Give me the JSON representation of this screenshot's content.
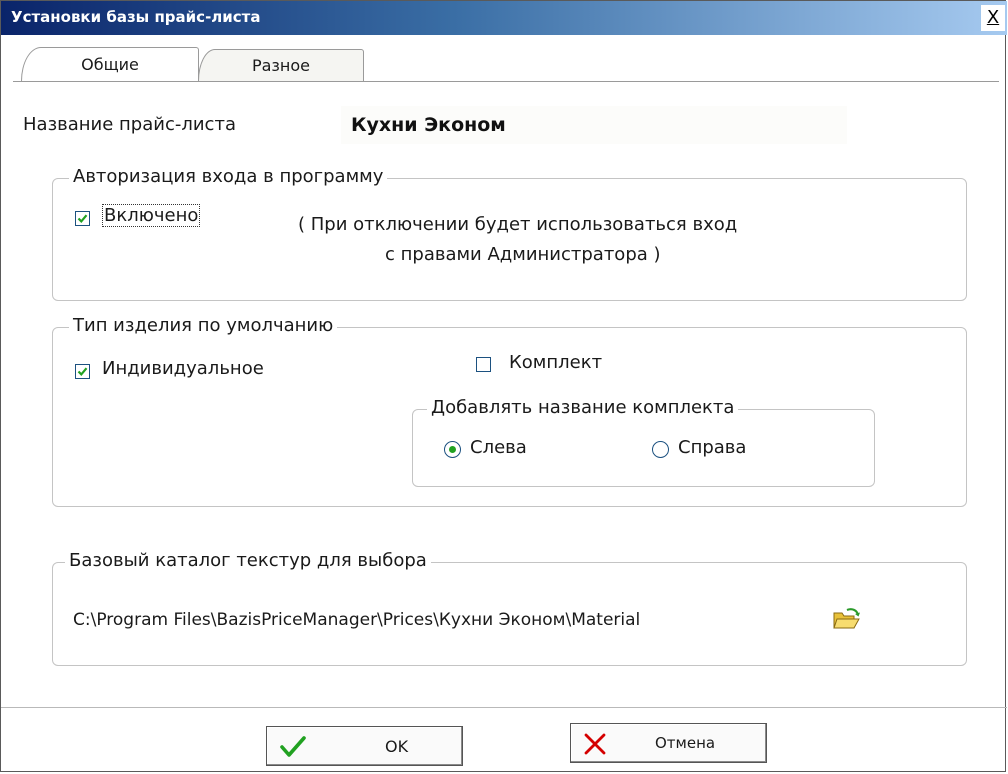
{
  "window": {
    "title": "Установки базы прайс-листа",
    "close_label": "X"
  },
  "tabs": [
    {
      "label": "Общие",
      "active": true
    },
    {
      "label": "Разное",
      "active": false
    }
  ],
  "price_list": {
    "name_label": "Название прайс-листа",
    "name_value": "Кухни Эконом"
  },
  "auth_group": {
    "legend": "Авторизация входа в программу",
    "enabled_label": "Включено",
    "enabled_checked": true,
    "note_line1": "( При отключении будет использоваться  вход",
    "note_line2": "с правами Администратора )"
  },
  "product_type_group": {
    "legend": "Тип изделия по умолчанию",
    "individual_label": "Индивидуальное",
    "individual_checked": true,
    "set_label": "Комплект",
    "set_checked": false,
    "add_name_group": {
      "legend": "Добавлять название комплекта",
      "left_label": "Слева",
      "right_label": "Справа",
      "selected": "Слева"
    }
  },
  "texture_group": {
    "legend": "Базовый каталог текстур для выбора",
    "path": "C:\\Program Files\\BazisPriceManager\\Prices\\Кухни Эконом\\Material"
  },
  "buttons": {
    "ok_label": "OK",
    "cancel_label": "Отмена"
  },
  "colors": {
    "title_gradient_start": "#0a246a",
    "title_gradient_end": "#a6caf0",
    "check_green": "#21a121",
    "cancel_red": "#d40000"
  }
}
